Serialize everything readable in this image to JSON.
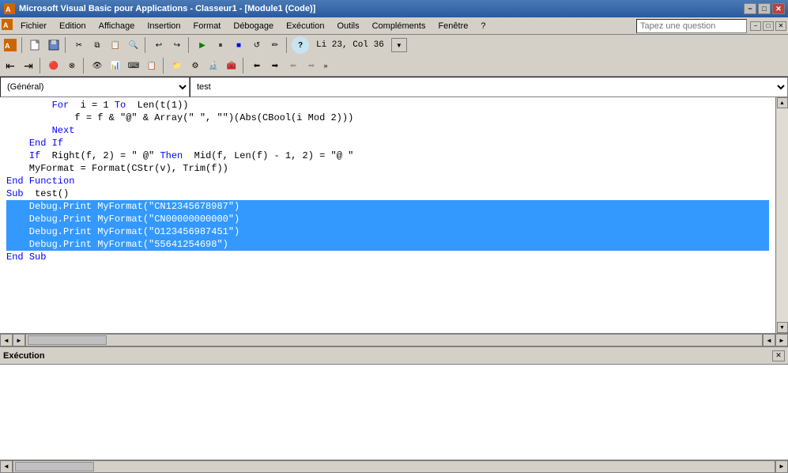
{
  "titlebar": {
    "icon": "VBA",
    "title": "Microsoft Visual Basic pour Applications - Classeur1 - [Module1 (Code)]",
    "minimize": "−",
    "restore": "□",
    "close": "✕"
  },
  "menubar": {
    "items": [
      {
        "id": "fichier",
        "label": "Fichier"
      },
      {
        "id": "edition",
        "label": "Edition"
      },
      {
        "id": "affichage",
        "label": "Affichage"
      },
      {
        "id": "insertion",
        "label": "Insertion"
      },
      {
        "id": "format",
        "label": "Format"
      },
      {
        "id": "debogage",
        "label": "Débogage"
      },
      {
        "id": "execution",
        "label": "Exécution"
      },
      {
        "id": "outils",
        "label": "Outils"
      },
      {
        "id": "complements",
        "label": "Compléments"
      },
      {
        "id": "fenetre",
        "label": "Fenêtre"
      },
      {
        "id": "aide",
        "label": "?"
      }
    ],
    "search_placeholder": "Tapez une question",
    "win_min": "−",
    "win_restore": "□",
    "win_close": "✕"
  },
  "toolbar": {
    "status": "Li 23, Col 36"
  },
  "editor": {
    "scope": "(Général)",
    "procedure": "test",
    "lines": [
      {
        "id": 1,
        "text": "        For i = 1 To Len(t(1))",
        "selected": false
      },
      {
        "id": 2,
        "text": "            f = f & \"@\" & Array(\" \", \"\")(Abs(CBool(i Mod 2)))",
        "selected": false
      },
      {
        "id": 3,
        "text": "        Next",
        "selected": false
      },
      {
        "id": 4,
        "text": "    End If",
        "selected": false
      },
      {
        "id": 5,
        "text": "    If Right(f, 2) = \" @\" Then Mid(f, Len(f) - 1, 2) = \"@ \"",
        "selected": false
      },
      {
        "id": 6,
        "text": "    MyFormat = Format(CStr(v), Trim(f))",
        "selected": false
      },
      {
        "id": 7,
        "text": "End Function",
        "selected": false
      },
      {
        "id": 8,
        "text": "Sub test()",
        "selected": false
      },
      {
        "id": 9,
        "text": "    Debug.Print MyFormat(\"CN12345678987\")",
        "selected": true
      },
      {
        "id": 10,
        "text": "    Debug.Print MyFormat(\"CN00000000000\")",
        "selected": true
      },
      {
        "id": 11,
        "text": "    Debug.Print MyFormat(\"O123456987451\")",
        "selected": true
      },
      {
        "id": 12,
        "text": "    Debug.Print MyFormat(\"55641254698\")",
        "selected": true
      },
      {
        "id": 13,
        "text": "End Sub",
        "selected": false
      }
    ]
  },
  "execution": {
    "title": "Exécution",
    "close": "✕"
  },
  "icons": {
    "run": "▶",
    "pause": "⏸",
    "stop": "■",
    "step": "⤵",
    "arrow_up": "▲",
    "arrow_down": "▼",
    "arrow_left": "◄",
    "arrow_right": "►",
    "dropdown": "▼",
    "chevron_down": "▼",
    "chevron_up": "▲"
  }
}
